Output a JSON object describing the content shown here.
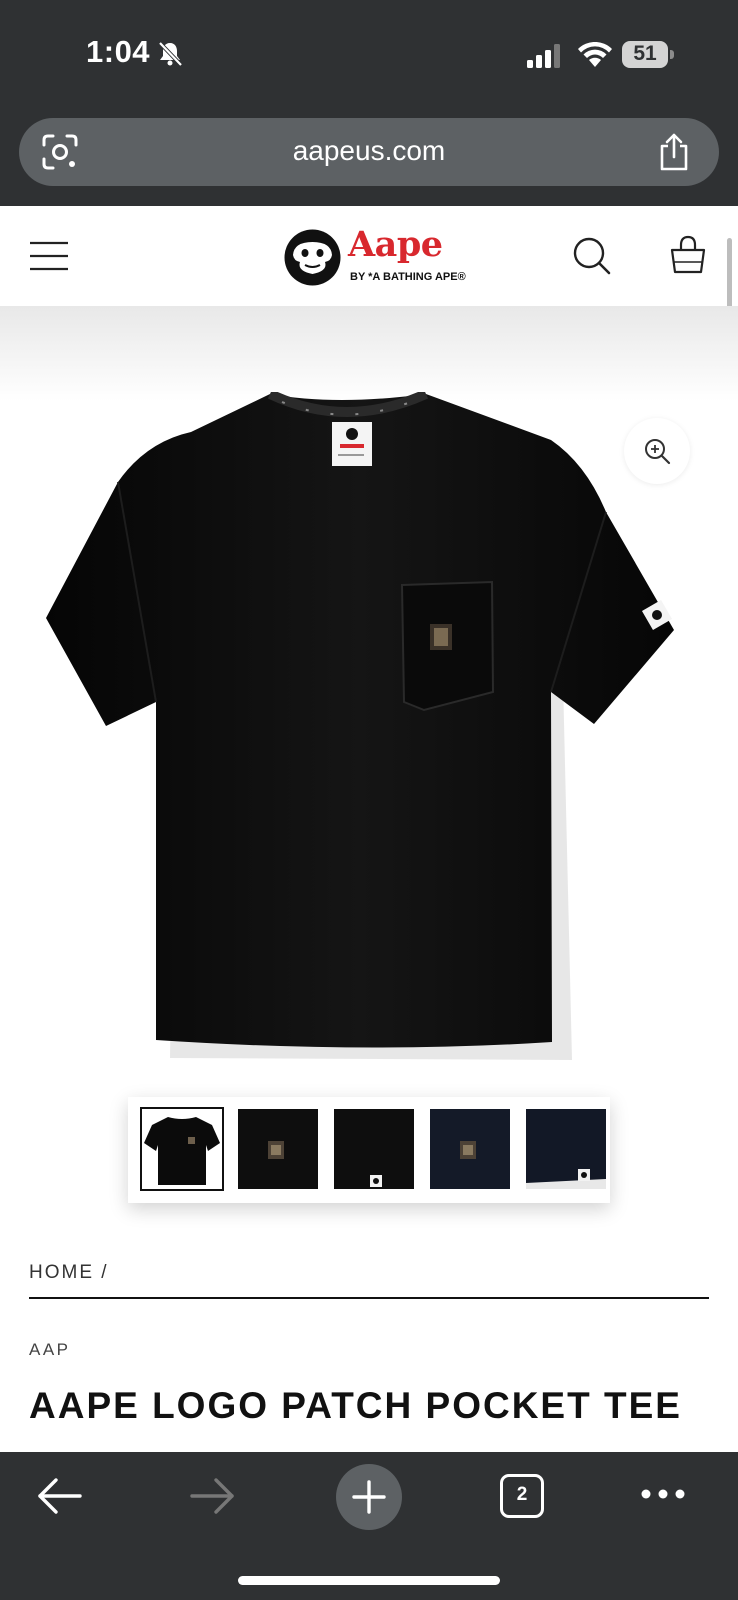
{
  "status_bar": {
    "time": "1:04",
    "battery": "51"
  },
  "browser": {
    "url": "aapeus.com",
    "open_tabs": "2"
  },
  "site": {
    "logo_word": "Aape",
    "logo_sub": "BY *A BATHING APE®",
    "brand_color": "#d8282e"
  },
  "icons": {
    "menu": "hamburger-menu-icon",
    "search": "search-icon",
    "bag": "shopping-bag-icon",
    "zoom": "zoom-in-icon",
    "lens": "lens-icon",
    "share": "share-icon"
  },
  "gallery": {
    "thumbnails": [
      "front",
      "pocket-patch",
      "sleeve-patch",
      "navy-pocket",
      "navy-sleeve"
    ],
    "selected_index": 0
  },
  "product": {
    "breadcrumb": "HOME /",
    "brand": "AAP",
    "title": "AAPE LOGO PATCH POCKET TEE"
  }
}
